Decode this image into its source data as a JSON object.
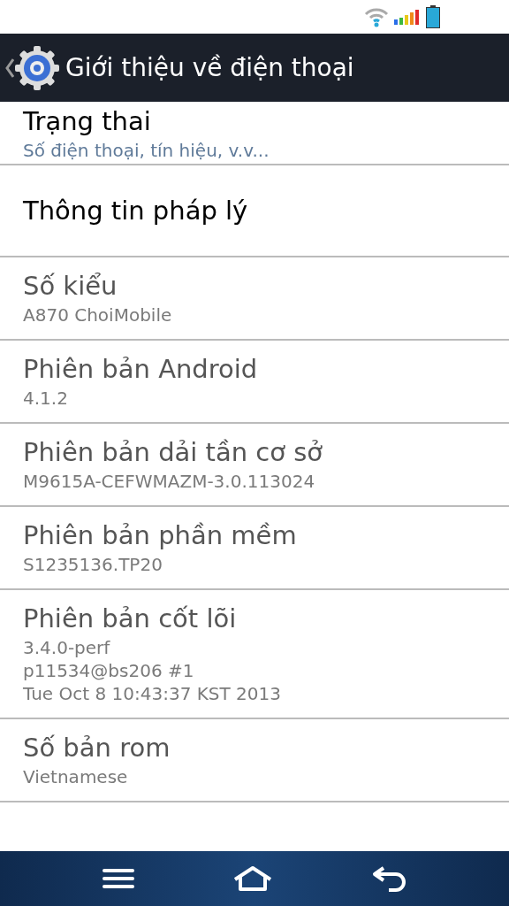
{
  "action_bar": {
    "title": "Giới thiệu về điện thoại"
  },
  "items": [
    {
      "title": "Trạng thai",
      "subtitle": [
        "Số điện thoại, tín hiệu, v.v..."
      ],
      "disabled": false
    },
    {
      "title": "Thông tin pháp lý",
      "disabled": false
    },
    {
      "title": "Số kiểu",
      "subtitle": [
        "A870 ChoiMobile"
      ],
      "disabled": true
    },
    {
      "title": "Phiên bản Android",
      "subtitle": [
        "4.1.2"
      ],
      "disabled": true
    },
    {
      "title": "Phiên bản dải tần cơ sở",
      "subtitle": [
        "M9615A-CEFWMAZM-3.0.113024"
      ],
      "disabled": true
    },
    {
      "title": "Phiên bản phần mềm",
      "subtitle": [
        "S1235136.TP20"
      ],
      "disabled": true
    },
    {
      "title": "Phiên bản cốt lõi",
      "subtitle": [
        "3.4.0-perf",
        "p11534@bs206 #1",
        "Tue Oct 8 10:43:37 KST 2013"
      ],
      "disabled": true
    },
    {
      "title": "Số bản rom",
      "subtitle": [
        "Vietnamese"
      ],
      "disabled": true
    }
  ]
}
